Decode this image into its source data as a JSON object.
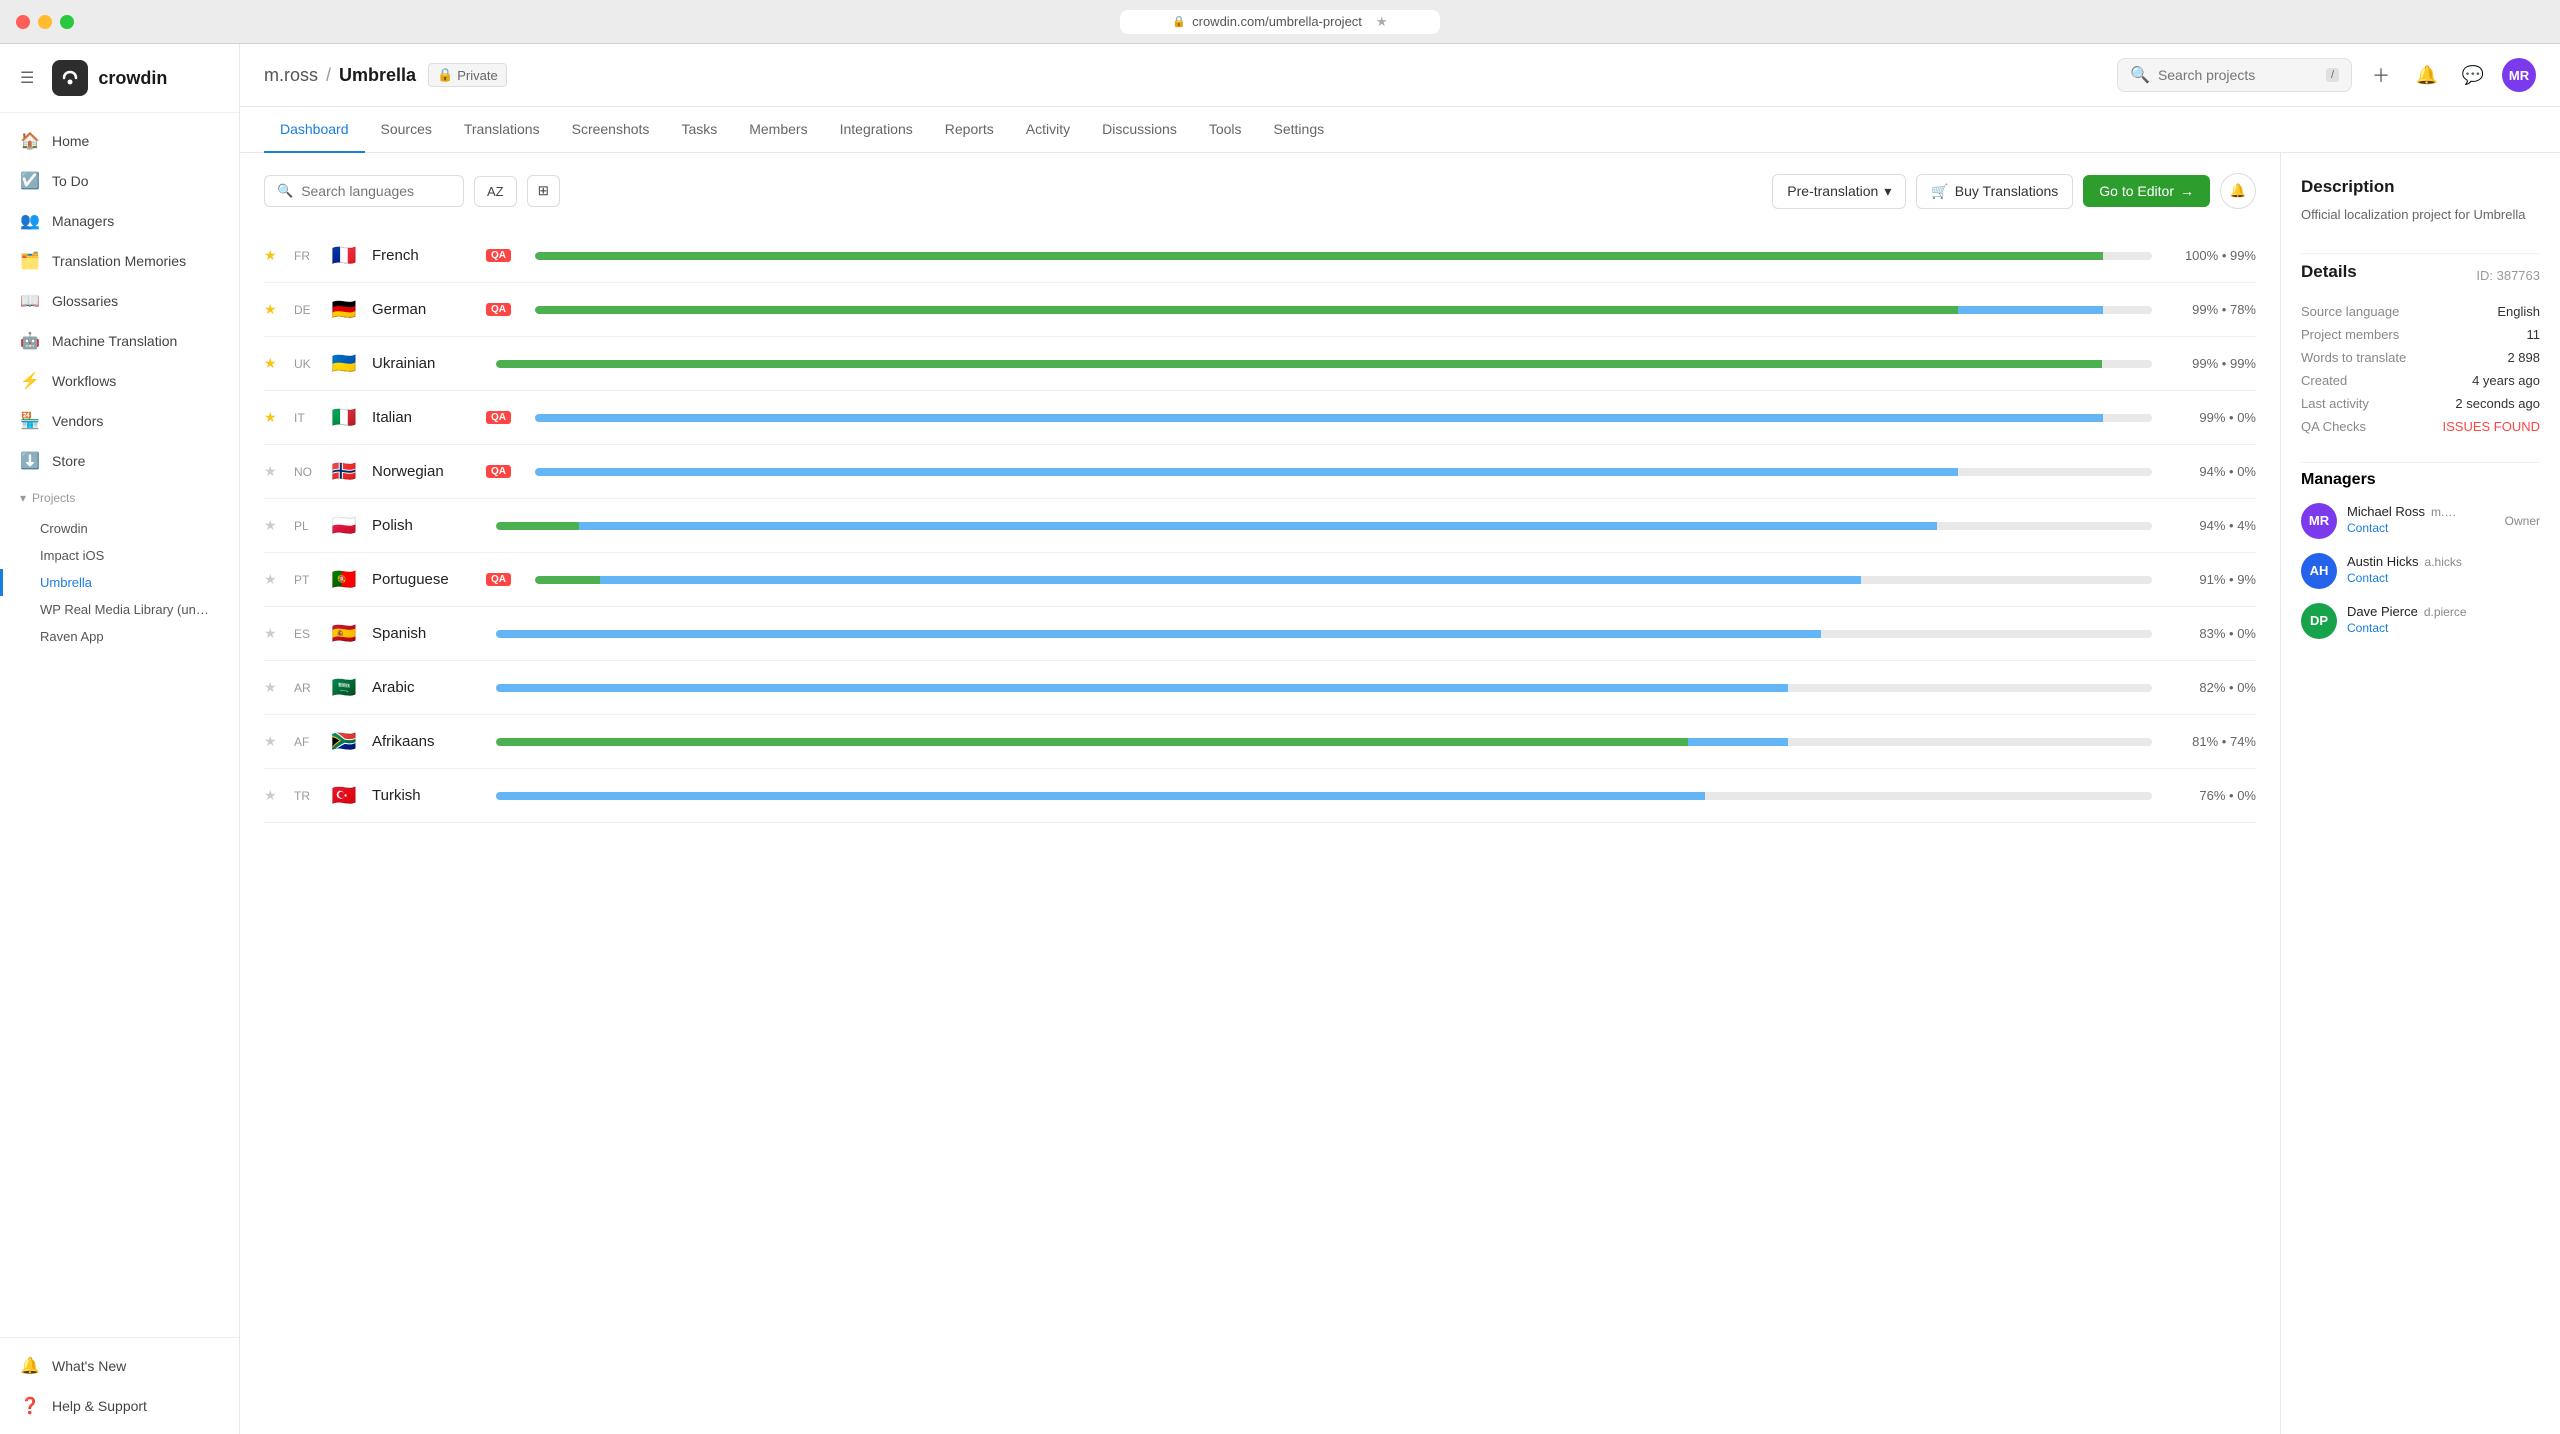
{
  "titlebar": {
    "url": "crowdin.com/umbrella-project",
    "close_label": "●",
    "min_label": "●",
    "max_label": "●"
  },
  "sidebar": {
    "brand": "crowdin",
    "nav_items": [
      {
        "id": "home",
        "label": "Home",
        "icon": "🏠"
      },
      {
        "id": "todo",
        "label": "To Do",
        "icon": "📋"
      },
      {
        "id": "managers",
        "label": "Managers",
        "icon": "👥"
      },
      {
        "id": "translation-memories",
        "label": "Translation Memories",
        "icon": "🗂️"
      },
      {
        "id": "glossaries",
        "label": "Glossaries",
        "icon": "📚"
      },
      {
        "id": "machine-translation",
        "label": "Machine Translation",
        "icon": "🤖"
      },
      {
        "id": "workflows",
        "label": "Workflows",
        "icon": "⚙️"
      },
      {
        "id": "vendors",
        "label": "Vendors",
        "icon": "🏪"
      },
      {
        "id": "store",
        "label": "Store",
        "icon": "🛒"
      }
    ],
    "projects_label": "Projects",
    "projects": [
      {
        "id": "crowdin",
        "label": "Crowdin"
      },
      {
        "id": "impact-ios",
        "label": "Impact iOS"
      },
      {
        "id": "umbrella",
        "label": "Umbrella",
        "active": true
      },
      {
        "id": "wp-real-media",
        "label": "WP Real Media Library (un…"
      },
      {
        "id": "raven-app",
        "label": "Raven App"
      }
    ],
    "whats_new": "What's New",
    "help": "Help & Support"
  },
  "header": {
    "breadcrumb_user": "m.ross",
    "breadcrumb_project": "Umbrella",
    "private_label": "Private",
    "search_placeholder": "Search projects",
    "search_kbd": "/",
    "avatar_initials": "MR"
  },
  "tabs": [
    {
      "id": "dashboard",
      "label": "Dashboard",
      "active": true
    },
    {
      "id": "sources",
      "label": "Sources"
    },
    {
      "id": "translations",
      "label": "Translations"
    },
    {
      "id": "screenshots",
      "label": "Screenshots"
    },
    {
      "id": "tasks",
      "label": "Tasks"
    },
    {
      "id": "members",
      "label": "Members"
    },
    {
      "id": "integrations",
      "label": "Integrations"
    },
    {
      "id": "reports",
      "label": "Reports"
    },
    {
      "id": "activity",
      "label": "Activity"
    },
    {
      "id": "discussions",
      "label": "Discussions"
    },
    {
      "id": "tools",
      "label": "Tools"
    },
    {
      "id": "settings",
      "label": "Settings"
    }
  ],
  "toolbar": {
    "search_languages_placeholder": "Search languages",
    "sort_label": "AZ",
    "pretranslation_label": "Pre-translation",
    "buy_label": "Buy Translations",
    "go_editor_label": "Go to Editor"
  },
  "languages": [
    {
      "flag": "🇫🇷",
      "code": "FR",
      "name": "French",
      "qa": true,
      "starred": true,
      "green_pct": 97,
      "blue_pct": 0,
      "label": "100% • 99%"
    },
    {
      "flag": "🇩🇪",
      "code": "DE",
      "name": "German",
      "qa": true,
      "starred": true,
      "green_pct": 88,
      "blue_pct": 9,
      "label": "99% • 78%"
    },
    {
      "flag": "🇺🇦",
      "code": "UK",
      "name": "Ukrainian",
      "qa": false,
      "starred": true,
      "green_pct": 97,
      "blue_pct": 0,
      "label": "99% • 99%"
    },
    {
      "flag": "🇮🇹",
      "code": "IT",
      "name": "Italian",
      "qa": true,
      "starred": true,
      "green_pct": 0,
      "blue_pct": 97,
      "label": "99% • 0%"
    },
    {
      "flag": "🇳🇴",
      "code": "NO",
      "name": "Norwegian",
      "qa": true,
      "starred": false,
      "green_pct": 0,
      "blue_pct": 88,
      "label": "94% • 0%"
    },
    {
      "flag": "🇵🇱",
      "code": "PL",
      "name": "Polish",
      "qa": false,
      "starred": false,
      "green_pct": 5,
      "blue_pct": 82,
      "label": "94% • 4%"
    },
    {
      "flag": "🇵🇹",
      "code": "PT",
      "name": "Portuguese",
      "qa": true,
      "starred": false,
      "green_pct": 4,
      "blue_pct": 78,
      "label": "91% • 9%"
    },
    {
      "flag": "🇪🇸",
      "code": "ES",
      "name": "Spanish",
      "qa": false,
      "starred": false,
      "green_pct": 0,
      "blue_pct": 80,
      "label": "83% • 0%"
    },
    {
      "flag": "🇸🇦",
      "code": "AR",
      "name": "Arabic",
      "qa": false,
      "starred": false,
      "green_pct": 0,
      "blue_pct": 78,
      "label": "82% • 0%"
    },
    {
      "flag": "🇿🇦",
      "code": "AF",
      "name": "Afrikaans",
      "qa": false,
      "starred": false,
      "green_pct": 72,
      "blue_pct": 6,
      "label": "81% • 74%"
    },
    {
      "flag": "🇹🇷",
      "code": "TR",
      "name": "Turkish",
      "qa": false,
      "starred": false,
      "green_pct": 0,
      "blue_pct": 73,
      "label": "76% • 0%"
    }
  ],
  "right_panel": {
    "description_title": "Description",
    "description_text": "Official localization project for Umbrella",
    "details_title": "Details",
    "details_id": "ID: 387763",
    "source_language_label": "Source language",
    "source_language_value": "English",
    "project_members_label": "Project members",
    "project_members_value": "11",
    "words_to_translate_label": "Words to translate",
    "words_to_translate_value": "2 898",
    "created_label": "Created",
    "created_value": "4 years ago",
    "last_activity_label": "Last activity",
    "last_activity_value": "2 seconds ago",
    "qa_checks_label": "QA Checks",
    "qa_checks_value": "ISSUES FOUND",
    "managers_title": "Managers",
    "managers": [
      {
        "initials": "MR",
        "name": "Michael Ross",
        "handle": "m.…",
        "contact": "Contact",
        "role": "Owner",
        "color": "av-purple"
      },
      {
        "initials": "AH",
        "name": "Austin Hicks",
        "handle": "a.hicks",
        "contact": "Contact",
        "role": "",
        "color": "av-blue"
      },
      {
        "initials": "DP",
        "name": "Dave Pierce",
        "handle": "d.pierce",
        "contact": "Contact",
        "role": "",
        "color": "av-green"
      }
    ]
  }
}
